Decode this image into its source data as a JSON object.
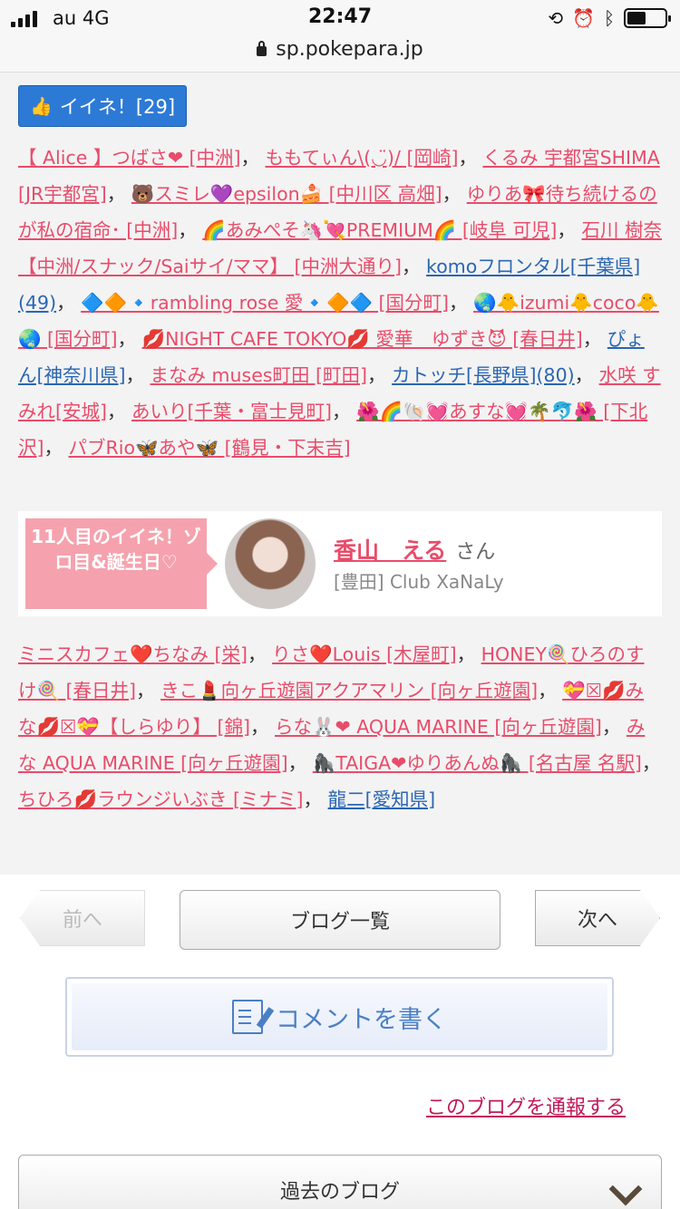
{
  "status_bar": {
    "carrier": "au   4G",
    "time": "22:47",
    "url": "sp.pokepara.jp",
    "icons": [
      "orientation-lock-icon",
      "alarm-icon",
      "bluetooth-icon",
      "battery-icon"
    ]
  },
  "like_button": {
    "label": "イイネ！[29]"
  },
  "likers_top": [
    {
      "text": "【 Alice 】つばさ❤ [中洲]",
      "color": "pink"
    },
    {
      "text": "ももてぃん\\(◡̈)/ [岡崎]",
      "color": "pink"
    },
    {
      "text": "くるみ 宇都宮SHIMA [JR宇都宮]",
      "color": "pink"
    },
    {
      "text": "🐻スミレ💜epsilon🍰 [中川区 高畑]",
      "color": "pink"
    },
    {
      "text": "ゆりあ🎀待ち続けるのが私の宿命･ [中洲]",
      "color": "pink"
    },
    {
      "text": "🌈あみぺそ🦄💘PREMIUM🌈 [岐阜 可児]",
      "color": "pink"
    },
    {
      "text": "石川 樹奈【中洲/スナック/Saiサイ/ママ】 [中洲大通り]",
      "color": "pink"
    },
    {
      "text": "komoフロンタル[千葉県](49)",
      "color": "blue"
    },
    {
      "text": "🔷🔶🔹rambling rose 愛🔹🔶🔷 [国分町]",
      "color": "pink"
    },
    {
      "text": "🌏🐥izumi🐥coco🐥🌏 [国分町]",
      "color": "pink"
    },
    {
      "text": "💋NIGHT CAFE TOKYO💋 愛華　ゆずき😈 [春日井]",
      "color": "pink"
    },
    {
      "text": "ぴょん[神奈川県]",
      "color": "blue"
    },
    {
      "text": "まなみ muses町田 [町田]",
      "color": "pink"
    },
    {
      "text": "カトッチ[長野県](80)",
      "color": "blue"
    },
    {
      "text": "水咲 すみれ[安城]",
      "color": "pink"
    },
    {
      "text": "あいり[千葉・富士見町]",
      "color": "pink"
    },
    {
      "text": "🌺🌈🐚💓あすな💓🌴🐬🌺 [下北沢]",
      "color": "pink"
    },
    {
      "text": "パブRio🦋あや🦋 [鶴見・下末吉]",
      "color": "pink"
    }
  ],
  "feature": {
    "ribbon": "11人目のイイネ！ゾロ目&誕生日♡",
    "name": "香山　える",
    "san": "さん",
    "shop": "[豊田] Club XaNaLy"
  },
  "likers_bottom": [
    {
      "text": "ミニスカフェ❤️ちなみ [栄]",
      "color": "pink"
    },
    {
      "text": "りさ❤️Louis [木屋町]",
      "color": "pink"
    },
    {
      "text": "HONEY🍭ひろのすけ🍭 [春日井]",
      "color": "pink"
    },
    {
      "text": "きこ💄向ヶ丘遊園アクアマリン [向ヶ丘遊園]",
      "color": "pink"
    },
    {
      "text": "💝☒💋みな💋☒💝【しらゆり】 [錦]",
      "color": "pink"
    },
    {
      "text": "らな🐰❤ AQUA MARINE [向ヶ丘遊園]",
      "color": "pink"
    },
    {
      "text": "みな AQUA MARINE [向ヶ丘遊園]",
      "color": "pink"
    },
    {
      "text": "🦍TAIGA❤ゆりあんぬ🦍 [名古屋 名駅]",
      "color": "pink"
    },
    {
      "text": "ちひろ💋ラウンジいぶき [ミナミ]",
      "color": "pink"
    },
    {
      "text": "龍二[愛知県]",
      "color": "blue"
    }
  ],
  "pager": {
    "prev": "前へ",
    "list": "ブログ一覧",
    "next": "次へ"
  },
  "comment_button": {
    "label": "コメントを書く"
  },
  "report_link": "このブログを通報する",
  "past_blog": "過去のブログ"
}
